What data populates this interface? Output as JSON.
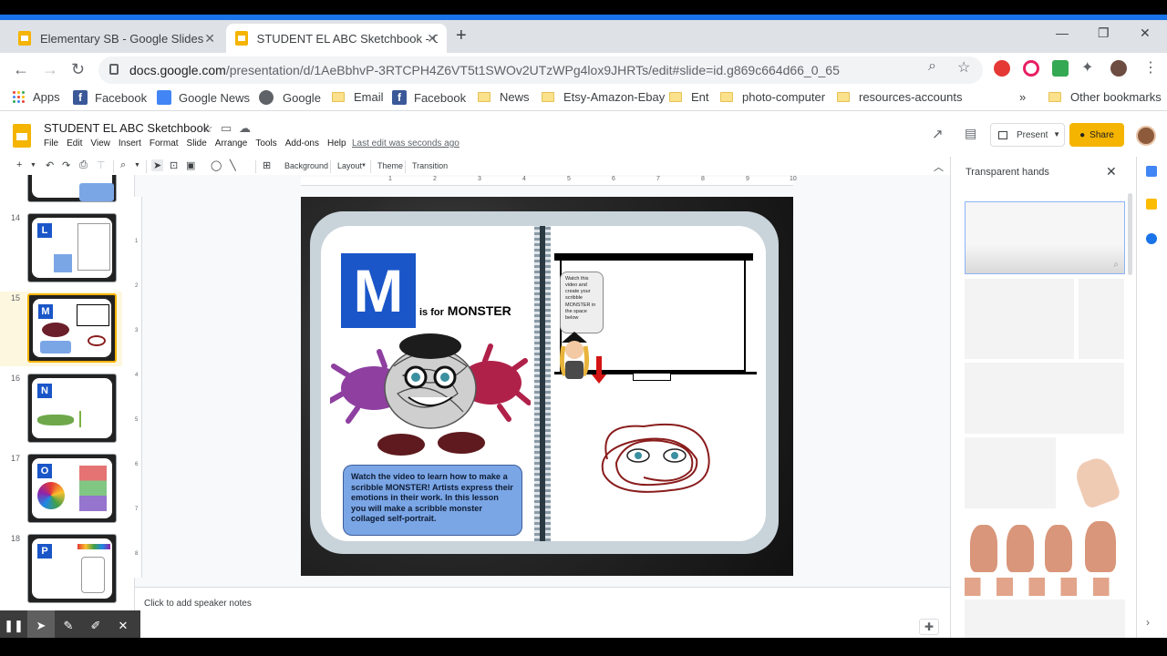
{
  "browser": {
    "tabs": [
      {
        "title": "Elementary SB - Google Slides",
        "active": false
      },
      {
        "title": "STUDENT EL ABC Sketchbook - G",
        "active": true
      }
    ],
    "new_tab": "+",
    "url_main": "docs.google.com",
    "url_rest": "/presentation/d/1AeBbhvP-3RTCPH4Z6VT5t1SWOv2UTzWPg4lox9JHRTs/edit#slide=id.g869c664d66_0_65",
    "bookmarks": [
      {
        "label": "Apps",
        "icon": "apps-grid-icon"
      },
      {
        "label": "Facebook",
        "icon": "facebook-icon"
      },
      {
        "label": "Google News",
        "icon": "google-news-icon"
      },
      {
        "label": "Google",
        "icon": "google-icon"
      },
      {
        "label": "Email",
        "icon": "folder-icon"
      },
      {
        "label": "Facebook",
        "icon": "facebook-icon"
      },
      {
        "label": "News",
        "icon": "folder-icon"
      },
      {
        "label": "Etsy-Amazon-Ebay",
        "icon": "folder-icon"
      },
      {
        "label": "Ent",
        "icon": "folder-icon"
      },
      {
        "label": "photo-computer",
        "icon": "folder-icon"
      },
      {
        "label": "resources-accounts",
        "icon": "folder-icon"
      }
    ],
    "more_bookmarks": "»",
    "other_bookmarks": "Other bookmarks"
  },
  "doc": {
    "title": "STUDENT EL ABC Sketchbook",
    "menu": [
      "File",
      "Edit",
      "View",
      "Insert",
      "Format",
      "Slide",
      "Arrange",
      "Tools",
      "Add-ons",
      "Help"
    ],
    "last_edit": "Last edit was seconds ago",
    "present_label": "Present",
    "share_label": "Share"
  },
  "toolbar": {
    "background": "Background",
    "layout": "Layout",
    "theme": "Theme",
    "transition": "Transition"
  },
  "ruler": {
    "h_ticks": [
      "1",
      "2",
      "3",
      "4",
      "5",
      "6",
      "7",
      "8",
      "9",
      "10"
    ],
    "v_ticks": [
      "1",
      "2",
      "3",
      "4",
      "5",
      "6",
      "7",
      "8"
    ]
  },
  "filmstrip": {
    "items": [
      {
        "num": "14",
        "letter": "L"
      },
      {
        "num": "15",
        "letter": "M",
        "selected": true
      },
      {
        "num": "16",
        "letter": "N"
      },
      {
        "num": "17",
        "letter": "O"
      },
      {
        "num": "18",
        "letter": "P"
      }
    ]
  },
  "slide": {
    "letter": "M",
    "is_for": "is for",
    "word": "MONSTER",
    "caption": "Watch the video to learn how to make a scribble MONSTER! Artists express their emotions in their work. In this lesson you will make a scribble monster collaged self-portrait.",
    "bubble": "Watch this video and create your scribble MONSTER in the space below"
  },
  "notes": {
    "placeholder": "Click to add speaker notes"
  },
  "side_panel": {
    "title": "Transparent hands",
    "close": "✕"
  },
  "colors": {
    "accent_blue": "#1a56c8",
    "slides_yellow": "#f4b400",
    "chrome_blue": "#1a73e8"
  }
}
